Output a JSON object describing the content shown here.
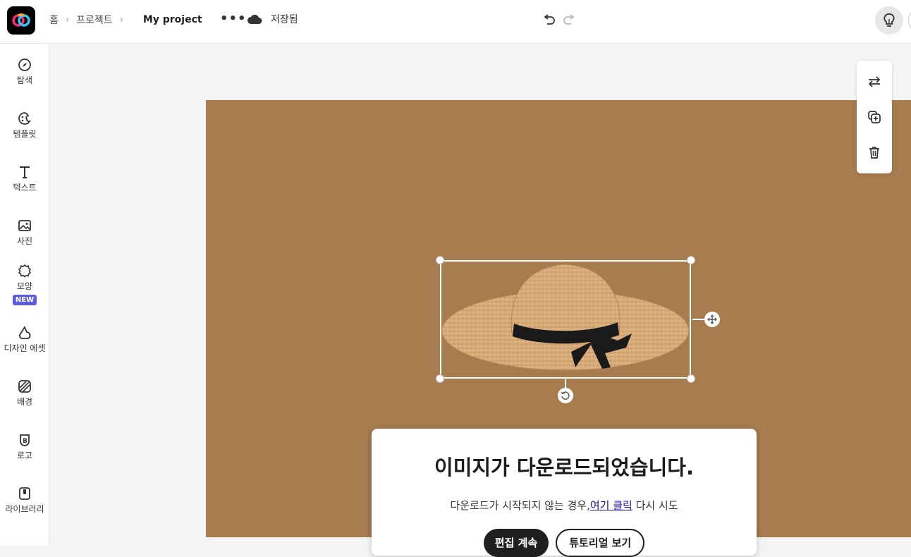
{
  "header": {
    "breadcrumbs": [
      "홈",
      "프로젝트"
    ],
    "project_name": "My project",
    "more_label": "•••",
    "save_status": "저장됨"
  },
  "sidebar": {
    "items": [
      {
        "label": "탐색",
        "icon": "compass-icon"
      },
      {
        "label": "템플릿",
        "icon": "template-icon"
      },
      {
        "label": "텍스트",
        "icon": "text-icon"
      },
      {
        "label": "사진",
        "icon": "photo-icon"
      },
      {
        "label": "모양",
        "icon": "shape-icon",
        "badge": "NEW"
      },
      {
        "label": "디자인 에셋",
        "icon": "design-assets-icon"
      },
      {
        "label": "배경",
        "icon": "background-icon"
      },
      {
        "label": "로고",
        "icon": "logo-icon"
      },
      {
        "label": "라이브러리",
        "icon": "library-icon"
      }
    ]
  },
  "canvas": {
    "background_color": "#a77c4e"
  },
  "right_tools": [
    "replace-icon",
    "duplicate-icon",
    "delete-icon"
  ],
  "modal": {
    "title": "이미지가 다운로드되었습니다.",
    "subtitle_prefix": "다운로드가 시작되지 않는 경우,",
    "subtitle_link": "여기 클릭",
    "subtitle_suffix": "다시 시도",
    "primary_button": "편집 계속",
    "secondary_button": "튜토리얼 보기"
  },
  "colors": {
    "accent_new_badge": "#5c5ce0",
    "link": "#1a0dab"
  }
}
